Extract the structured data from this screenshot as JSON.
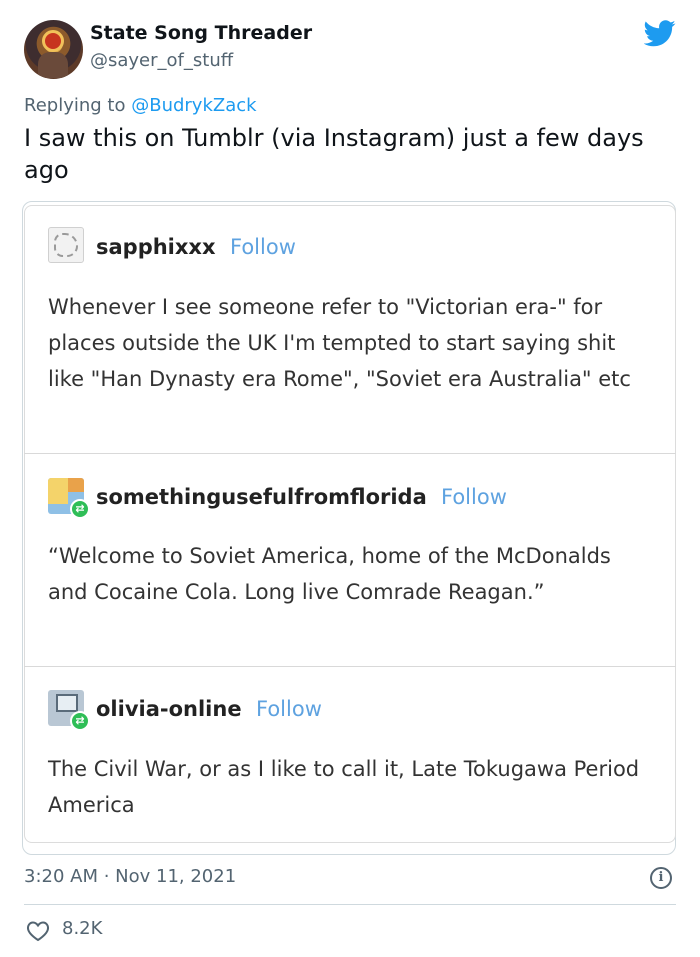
{
  "tweet": {
    "display_name": "State Song Threader",
    "handle": "@sayer_of_stuff",
    "replying_prefix": "Replying to",
    "replying_to": "@BudrykZack",
    "text": "I saw this on Tumblr (via Instagram) just a few days ago",
    "timestamp": "3:20 AM · Nov 11, 2021",
    "likes": "8.2K"
  },
  "tumblr_posts": [
    {
      "username": "sapphixxx",
      "follow_label": "Follow",
      "text": "Whenever I see someone refer to \"Victorian era-\" for places outside the UK I'm tempted to start saying shit like \"Han Dynasty era Rome\", \"Soviet era Australia\" etc"
    },
    {
      "username": "somethingusefulfromflorida",
      "follow_label": "Follow",
      "text": "“Welcome to Soviet America, home of the McDonalds and Cocaine Cola.  Long live Comrade Reagan.”"
    },
    {
      "username": "olivia-online",
      "follow_label": "Follow",
      "text": "The Civil War, or as I like to call it, Late Tokugawa Period America"
    }
  ],
  "icons": {
    "brand": "twitter-bird-icon",
    "info": "info-icon",
    "like": "heart-icon",
    "reblog": "reblog-icon"
  },
  "colors": {
    "twitter_blue": "#1d9bf0",
    "secondary_text": "#536471",
    "follow_blue": "#5ea2e0",
    "reblog_green": "#2fbe57"
  }
}
